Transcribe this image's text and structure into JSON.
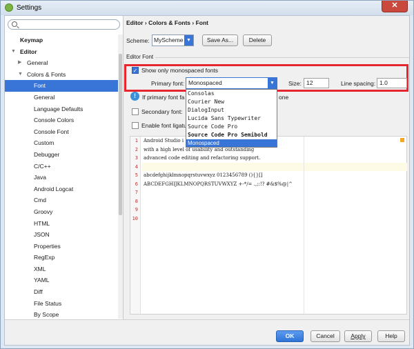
{
  "window": {
    "title": "Settings",
    "close_glyph": "✕"
  },
  "sidebar": {
    "search_placeholder": "",
    "items": [
      {
        "label": "Keymap",
        "bold": true
      },
      {
        "label": "Editor",
        "bold": true,
        "expanded": true
      },
      {
        "label": "General"
      },
      {
        "label": "Colors & Fonts",
        "expanded": true
      },
      {
        "label": "Font",
        "selected": true
      },
      {
        "label": "General"
      },
      {
        "label": "Language Defaults"
      },
      {
        "label": "Console Colors"
      },
      {
        "label": "Console Font"
      },
      {
        "label": "Custom"
      },
      {
        "label": "Debugger"
      },
      {
        "label": "C/C++"
      },
      {
        "label": "Java"
      },
      {
        "label": "Android Logcat"
      },
      {
        "label": "Cmd"
      },
      {
        "label": "Groovy"
      },
      {
        "label": "HTML"
      },
      {
        "label": "JSON"
      },
      {
        "label": "Properties"
      },
      {
        "label": "RegExp"
      },
      {
        "label": "XML"
      },
      {
        "label": "YAML"
      },
      {
        "label": "Diff"
      },
      {
        "label": "File Status"
      },
      {
        "label": "By Scope"
      }
    ]
  },
  "content": {
    "breadcrumb": "Editor › Colors & Fonts › Font",
    "scheme_label": "Scheme:",
    "scheme_value": "MyScheme",
    "save_as_label": "Save As...",
    "delete_label": "Delete",
    "section_title": "Editor Font",
    "monospaced_label": "Show only monospaced fonts",
    "primary_font_label": "Primary font:",
    "primary_font_value": "Monospaced",
    "size_label": "Size:",
    "size_value": "12",
    "line_spacing_label": "Line spacing:",
    "line_spacing_value": "1.0",
    "info_prefix": "If primary font fa",
    "info_suffix": "one",
    "secondary_font_label": "Secondary font:",
    "ligatures_label": "Enable font ligatu",
    "font_options": [
      {
        "label": "Consolas"
      },
      {
        "label": "Courier New"
      },
      {
        "label": "DialogInput"
      },
      {
        "label": "Lucida Sans Typewriter"
      },
      {
        "label": "Source Code Pro"
      },
      {
        "label": "Source Code Pro Semibold",
        "bold": true
      },
      {
        "label": "Monospaced",
        "selected": true
      }
    ]
  },
  "editor": {
    "line_numbers": [
      "1",
      "2",
      "3",
      "4",
      "5",
      "6",
      "7",
      "8",
      "9",
      "10"
    ],
    "lines": [
      "Android Studio i",
      "with a high level of usability and outstanding",
      "advanced code editing and refactoring support.",
      "",
      "abcdefghijklmnopqrstuvwxyz 0123456789 (){}[]",
      "ABCDEFGHIJKLMNOPQRSTUVWXYZ +-*/= .,;:!? #&$%@|^",
      "",
      "",
      "",
      ""
    ],
    "current_line": 4,
    "marker_color": "#f5a623"
  },
  "footer": {
    "ok_label": "OK",
    "cancel_label": "Cancel",
    "apply_label": "Apply",
    "help_label": "Help"
  },
  "colors": {
    "accent": "#3875d7",
    "highlight_box": "#e6262e"
  }
}
